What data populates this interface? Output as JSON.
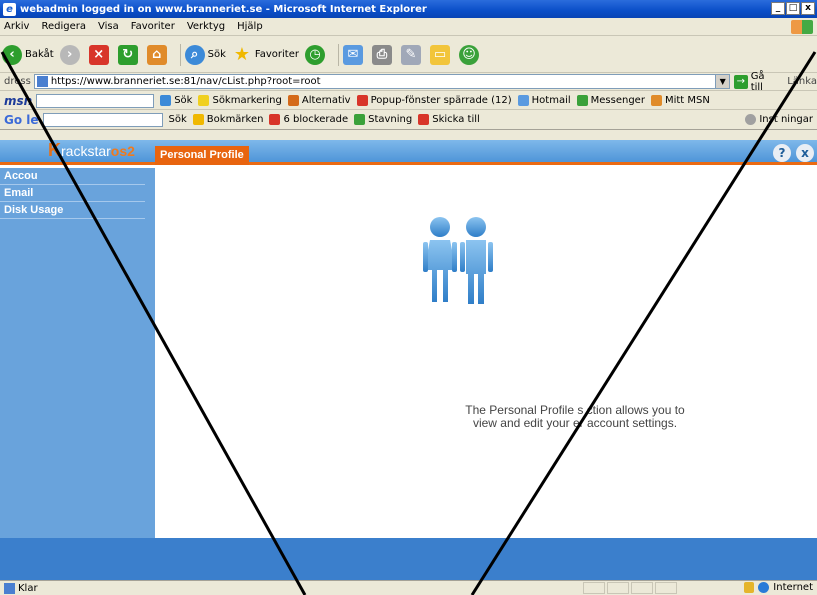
{
  "window": {
    "title": "webadmin logged in on www.branneriet.se - Microsoft Internet Explorer",
    "controls": [
      "_",
      "□",
      "x"
    ]
  },
  "menu": [
    "Arkiv",
    "Redigera",
    "Visa",
    "Favoriter",
    "Verktyg",
    "Hjälp"
  ],
  "toolbar": {
    "back": "Bakåt",
    "search": "Sök",
    "favorites": "Favoriter"
  },
  "address": {
    "label": "dress",
    "url": "https://www.branneriet.se:81/nav/cList.php?root=root",
    "go": "Gå till",
    "links": "Länka"
  },
  "msnbar": {
    "logo": "msn",
    "search": "Sök",
    "highlight": "Sökmarkering",
    "alternative": "Alternativ",
    "popup": "Popup-fönster spärrade (12)",
    "hotmail": "Hotmail",
    "messenger": "Messenger",
    "mymsn": "Mitt MSN"
  },
  "googlebar": {
    "logo": "Go  le",
    "search": "Sök",
    "bookmarks": "Bokmärken",
    "blocked": "6 blockerade",
    "spelling": "Stavning",
    "sendto": "Skicka till",
    "settings": "Inst  ningar"
  },
  "app": {
    "logo_letter": "K",
    "logo_text": "rackstar",
    "logo_suffix": "os2",
    "tab": "Personal Profile",
    "help": "?",
    "close": "x"
  },
  "sidebar": {
    "items": [
      "Accou",
      "Email",
      "Disk Usage"
    ]
  },
  "content": {
    "description_line1": "The Personal Profile s  ction allows you to",
    "description_line2": "view and edit your   er account settings."
  },
  "status": {
    "text": "Klar",
    "zone": "Internet"
  },
  "colors": {
    "header_blue": "#5c9fdf",
    "accent_orange": "#e8640f",
    "sidebar_blue": "#69a3dc",
    "footer_blue": "#3b7fcc"
  }
}
